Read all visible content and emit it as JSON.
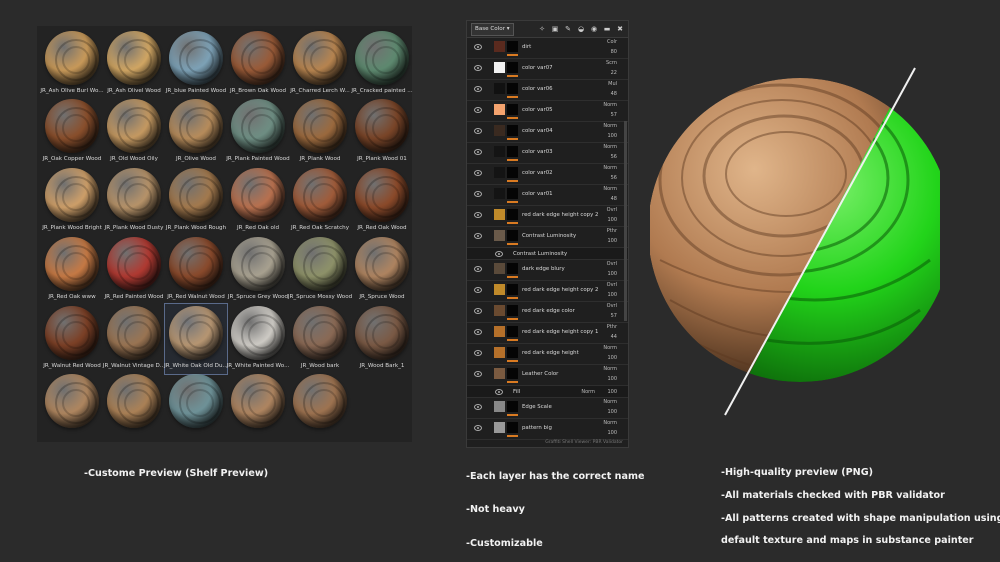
{
  "shelf": {
    "caption": "-Custome Preview (Shelf Preview)",
    "materials": [
      {
        "label": "JR_Ash Olive Burl Wo...",
        "color": "#c99a5a"
      },
      {
        "label": "JR_Ash Olivel Wood",
        "color": "#d2a764"
      },
      {
        "label": "JR_blue Painted Wood",
        "color": "#7ea3b8"
      },
      {
        "label": "JR_Brown Oak Wood",
        "color": "#9a5b38"
      },
      {
        "label": "JR_Charred Lerch W...",
        "color": "#b88550"
      },
      {
        "label": "JR_Cracked painted ...",
        "color": "#5e8a70"
      },
      {
        "label": "JR_Oak Copper Wood",
        "color": "#8a4f2c"
      },
      {
        "label": "JR_Old Wood Oily",
        "color": "#c69a62"
      },
      {
        "label": "JR_Olive Wood",
        "color": "#b88d5c"
      },
      {
        "label": "JR_Plank Painted Wood",
        "color": "#6f8f84"
      },
      {
        "label": "JR_Plank Wood",
        "color": "#9c6a3e"
      },
      {
        "label": "JR_Plank Wood 01",
        "color": "#7a4528"
      },
      {
        "label": "JR_Plank Wood Bright",
        "color": "#cfa06a"
      },
      {
        "label": "JR_Plank Wood Dusty",
        "color": "#b8946a"
      },
      {
        "label": "JR_Plank Wood Rough",
        "color": "#a47a4e"
      },
      {
        "label": "JR_Red Oak old",
        "color": "#b9714f"
      },
      {
        "label": "JR_Red Oak Scratchy",
        "color": "#a15c3a"
      },
      {
        "label": "JR_Red Oak Wood",
        "color": "#8c4a2a"
      },
      {
        "label": "JR_Red Oak www",
        "color": "#c77a45"
      },
      {
        "label": "JR_Red Painted Wood",
        "color": "#b13a32"
      },
      {
        "label": "JR_Red Walnut Wood",
        "color": "#8a4a2c"
      },
      {
        "label": "JR_Spruce Grey Wood",
        "color": "#a9a291"
      },
      {
        "label": "JR_Spruce Mossy Wood",
        "color": "#8f936a"
      },
      {
        "label": "JR_Spruce Wood",
        "color": "#b08561"
      },
      {
        "label": "JR_Walnut Red Wood",
        "color": "#7c4026"
      },
      {
        "label": "JR_Walnut Vintage D...",
        "color": "#9b7553"
      },
      {
        "label": "JR_White Oak Old Du...",
        "color": "#b89773"
      },
      {
        "label": "JR_White Painted Wo...",
        "color": "#cfccc6"
      },
      {
        "label": "JR_Wood bark",
        "color": "#8b6a55"
      },
      {
        "label": "JR_Wood Bark_1",
        "color": "#7b5a45"
      },
      {
        "label": "",
        "color": "#b08760"
      },
      {
        "label": "",
        "color": "#ac8257"
      },
      {
        "label": "",
        "color": "#6f9399"
      },
      {
        "label": "",
        "color": "#b08661"
      },
      {
        "label": "",
        "color": "#9f7451"
      }
    ]
  },
  "layers": {
    "channel": "Base Color",
    "toolbar_icons": [
      "wand-icon",
      "mask-icon",
      "brush-icon",
      "fill-icon",
      "smart-material-icon",
      "folder-icon",
      "trash-icon"
    ],
    "rows": [
      {
        "name": "dirt",
        "blend": "Colr",
        "opacity": "80",
        "thumb": "#5a2a1e"
      },
      {
        "name": "color var07",
        "blend": "Scrn",
        "opacity": "22",
        "thumb": "#f2f2f2"
      },
      {
        "name": "color var06",
        "blend": "Mul",
        "opacity": "48",
        "thumb": "#111111"
      },
      {
        "name": "color var05",
        "blend": "Norm",
        "opacity": "57",
        "thumb": "#f4a36e"
      },
      {
        "name": "color var04",
        "blend": "Norm",
        "opacity": "100",
        "thumb": "#3a2a20"
      },
      {
        "name": "color var03",
        "blend": "Norm",
        "opacity": "56",
        "thumb": "#141414"
      },
      {
        "name": "color var02",
        "blend": "Norm",
        "opacity": "56",
        "thumb": "#141414"
      },
      {
        "name": "color var01",
        "blend": "Norm",
        "opacity": "48",
        "thumb": "#141414"
      },
      {
        "name": "red dark edge height copy 2",
        "blend": "Ovrl",
        "opacity": "100",
        "thumb": "#c08a2a"
      },
      {
        "name": "Contrast Luminosity",
        "blend": "Pthr",
        "opacity": "100",
        "thumb": "#6a5a4a",
        "folder": true
      },
      {
        "name": "Contrast Luminosity",
        "blend": "",
        "opacity": "",
        "thumb": "",
        "sub": true
      },
      {
        "name": "dark edge blury",
        "blend": "Ovrl",
        "opacity": "100",
        "thumb": "#5a4a3a"
      },
      {
        "name": "red dark edge height copy 2",
        "blend": "Ovrl",
        "opacity": "100",
        "thumb": "#c08a2a"
      },
      {
        "name": "red dark edge color",
        "blend": "Ovrl",
        "opacity": "57",
        "thumb": "#6a4a30"
      },
      {
        "name": "red dark edge height copy 1",
        "blend": "Pthr",
        "opacity": "44",
        "thumb": "#b5702a"
      },
      {
        "name": "red dark edge height",
        "blend": "Norm",
        "opacity": "100",
        "thumb": "#b5702a"
      },
      {
        "name": "Leather Color",
        "blend": "Norm",
        "opacity": "100",
        "thumb": "#7a5a40",
        "folder": true
      },
      {
        "name": "Fill",
        "blend": "Norm",
        "opacity": "100",
        "thumb": "",
        "sub": true
      },
      {
        "name": "Edge Scale",
        "blend": "Norm",
        "opacity": "100",
        "thumb": "#888888"
      },
      {
        "name": "pattern big",
        "blend": "Norm",
        "opacity": "100",
        "thumb": "#999999"
      }
    ],
    "footer": "Graffiti Shell Viewer: PBR Validator",
    "captions": [
      "-Each layer has the correct name",
      "-Not heavy",
      "-Customizable"
    ]
  },
  "preview": {
    "wood_color": "#b07a50",
    "green_color": "#22d41a",
    "captions": [
      "-High-quality preview (PNG)",
      "-All materials checked with PBR validator",
      "-All patterns created with shape manipulation using",
      "default texture and maps in substance painter"
    ]
  }
}
